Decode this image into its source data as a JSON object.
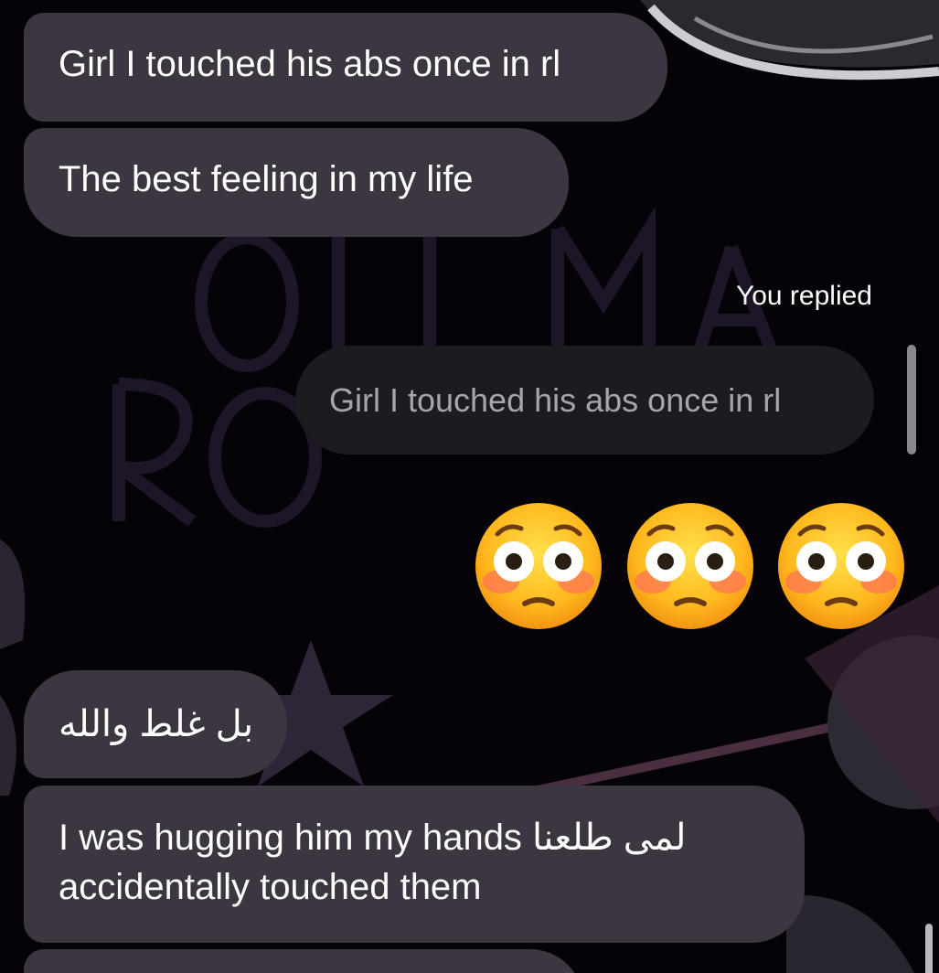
{
  "thread": {
    "messages": [
      {
        "text": "Girl I touched his abs once in rl"
      },
      {
        "text": "The best feeling in my life"
      },
      {
        "reply_label": "You replied",
        "quoted_text": "Girl I touched his abs once in rl"
      },
      {
        "reaction": "flushed-face",
        "emoji": "😳😳😳"
      },
      {
        "text": "بل غلط والله"
      },
      {
        "text_line1": "I was hugging him my hands لمى طلعنا",
        "text_line2": "accidentally touched them"
      }
    ]
  },
  "colors": {
    "incoming_bubble": "#3b3640",
    "quoted_bubble": "#1d1b20",
    "quoted_text": "#a8a4ad",
    "background": "#050308"
  }
}
